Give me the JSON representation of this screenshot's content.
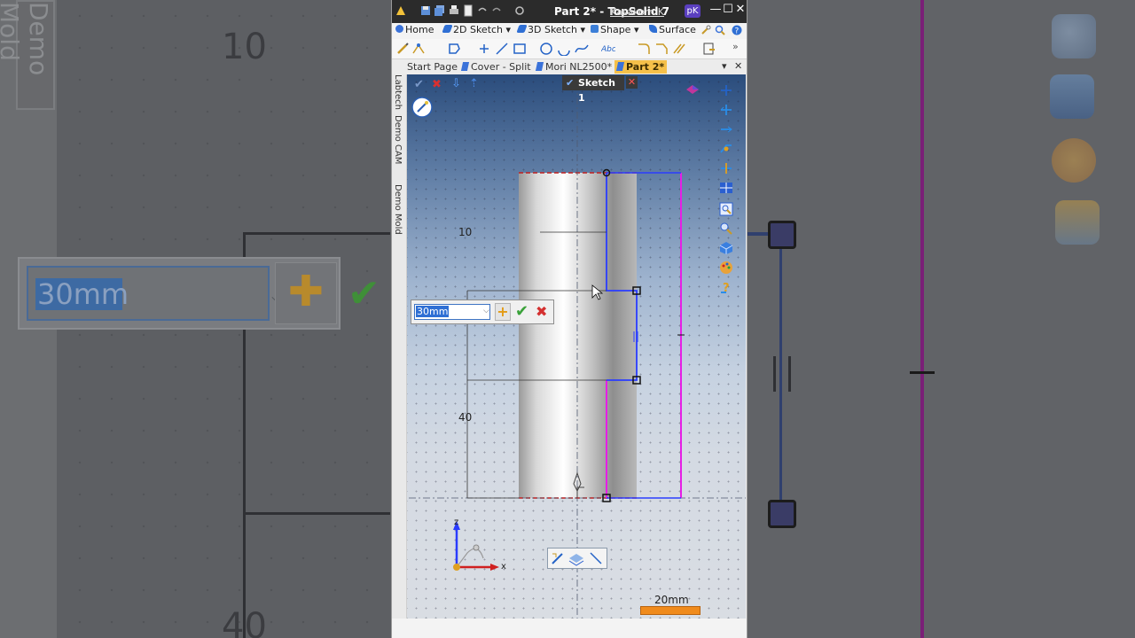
{
  "background": {
    "side_tab_label": "Demo Mold",
    "dim_top": "10",
    "dim_bottom": "40",
    "edit_value": "30mm"
  },
  "window": {
    "title": "Part 2* - TopSolid 7",
    "user_name": "Kasakorn K",
    "user_badge": "pK",
    "controls": {
      "minimize": "—",
      "maximize": "☐",
      "close": "✕"
    }
  },
  "menu": {
    "items": [
      {
        "label": "Home",
        "color": "#3a72d9"
      },
      {
        "label": "2D Sketch",
        "color": "#2f6fd4"
      },
      {
        "label": "3D Sketch",
        "color": "#2f6fd4"
      },
      {
        "label": "Shape",
        "color": "#3c7fd8"
      },
      {
        "label": "Surface",
        "color": "#2f6fd4"
      }
    ],
    "overflow": "»"
  },
  "doc_tabs": {
    "tabs": [
      {
        "label": "Start Page",
        "active": false
      },
      {
        "label": "Cover - Split",
        "active": true
      },
      {
        "label": "Mori NL2500*",
        "active": false
      },
      {
        "label": "Part 2*",
        "active": true
      }
    ],
    "menu_glyph": "▾",
    "close_glyph": "✕"
  },
  "side_tabs": [
    "Labtech",
    "Demo CAM",
    "Demo Mold"
  ],
  "sketch": {
    "badge_label": "Sketch 1",
    "close_glyph": "✕"
  },
  "dimensions": {
    "upper": "10",
    "lower": "40"
  },
  "dimension_editor": {
    "value": "30mm",
    "plus": "+",
    "ok": "✔",
    "cancel": "✖"
  },
  "axes": {
    "z": "z",
    "x": "x"
  },
  "scale": {
    "label": "20mm"
  },
  "colors": {
    "profile": "#7b1cff",
    "magenta": "#e61ee6",
    "blue_sketch": "#2a3cff",
    "scale_bar": "#f08b1c",
    "title_bg": "#2b2b2b"
  }
}
